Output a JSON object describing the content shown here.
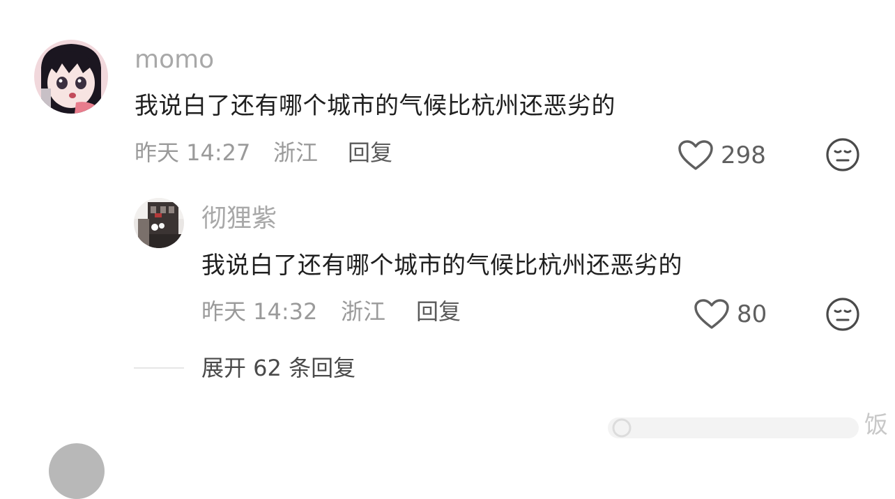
{
  "comments": [
    {
      "username": "momo",
      "text": "我说白了还有哪个城市的气候比杭州还恶劣的",
      "time": "昨天 14:27",
      "location": "浙江",
      "reply_label": "回复",
      "likes": "298"
    }
  ],
  "reply": {
    "username": "彻狸紫",
    "text": "我说白了还有哪个城市的气候比杭州还恶劣的",
    "time": "昨天 14:32",
    "location": "浙江",
    "reply_label": "回复",
    "likes": "80"
  },
  "expand_label": "展开 62 条回复",
  "watermark_text": "饭",
  "colors": {
    "username": "#a8a8a8",
    "meta": "#9a9a9a",
    "text": "#1f1f1f"
  },
  "icons": [
    "heart-icon",
    "neutral-face-icon"
  ]
}
